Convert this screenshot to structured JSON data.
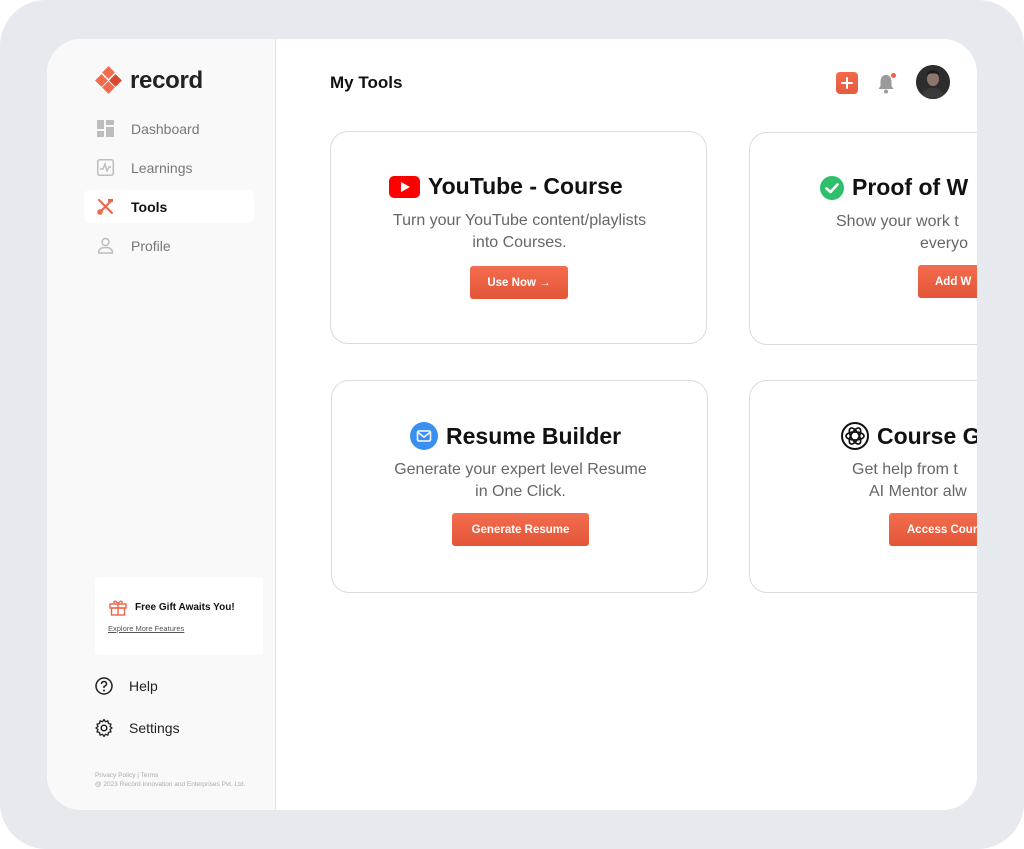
{
  "brand": {
    "name": "record",
    "accent": "#ef6448"
  },
  "sidebar": {
    "items": [
      {
        "label": "Dashboard",
        "icon": "dashboard-icon",
        "active": false
      },
      {
        "label": "Learnings",
        "icon": "learnings-icon",
        "active": false
      },
      {
        "label": "Tools",
        "icon": "tools-icon",
        "active": true
      },
      {
        "label": "Profile",
        "icon": "profile-icon",
        "active": false
      }
    ],
    "gift": {
      "title": "Free Gift Awaits You!",
      "link": "Explore More Features",
      "icon": "gift-icon"
    },
    "bottom": [
      {
        "label": "Help",
        "icon": "help-icon"
      },
      {
        "label": "Settings",
        "icon": "settings-icon"
      }
    ],
    "legal": {
      "links": "Privacy Policy | Terms",
      "copyright": "@ 2023 Record Innovation and Enterprises Pvt. Ltd."
    }
  },
  "header": {
    "title": "My Tools",
    "add_icon": "plus-icon",
    "bell_icon": "bell-icon"
  },
  "cards": [
    {
      "title": "YouTube - Course",
      "icon": "youtube-icon",
      "desc_line1": "Turn your YouTube content/playlists",
      "desc_line2": "into Courses.",
      "button": "Use Now →"
    },
    {
      "title": "Proof of W",
      "icon": "check-circle-icon",
      "desc_line1": "Show your work t",
      "desc_line2": "everyo",
      "button": "Add W"
    },
    {
      "title": "Resume Builder",
      "icon": "mail-icon",
      "desc_line1": "Generate your expert level Resume",
      "desc_line2": "in One Click.",
      "button": "Generate Resume"
    },
    {
      "title": "Course G",
      "icon": "openai-icon",
      "desc_line1": "Get help from t",
      "desc_line2": "AI Mentor alw",
      "button": "Access Cours"
    }
  ]
}
